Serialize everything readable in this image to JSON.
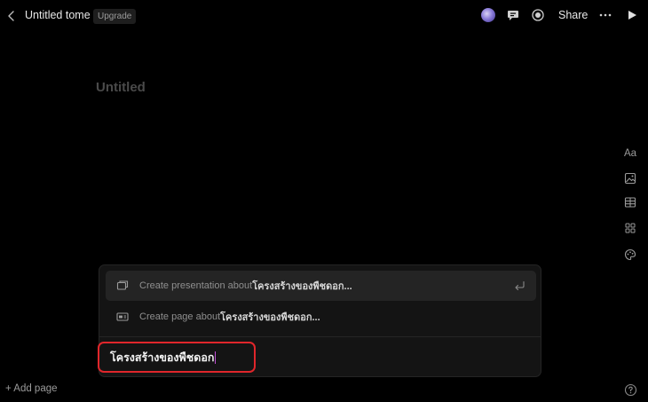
{
  "header": {
    "title": "Untitled tome",
    "upgrade_label": "Upgrade",
    "share_label": "Share"
  },
  "page": {
    "heading": "Untitled"
  },
  "right_toolbar": {
    "text_label": "Aa"
  },
  "command_menu": {
    "items": [
      {
        "label": "Create presentation about ",
        "topic": "โครงสร้างของพืชดอก...",
        "icon": "presentation-icon",
        "selected": true
      },
      {
        "label": "Create page about ",
        "topic": "โครงสร้างของพืชดอก...",
        "icon": "page-icon",
        "selected": false
      }
    ],
    "input_value": "โครงสร้างของพืชดอก"
  },
  "footer": {
    "add_page_label": "+ Add page"
  },
  "colors": {
    "background": "#000000",
    "panel": "#141414",
    "selected_item": "#242424",
    "highlight_border": "#e0262b",
    "caret": "#c14fd6"
  }
}
